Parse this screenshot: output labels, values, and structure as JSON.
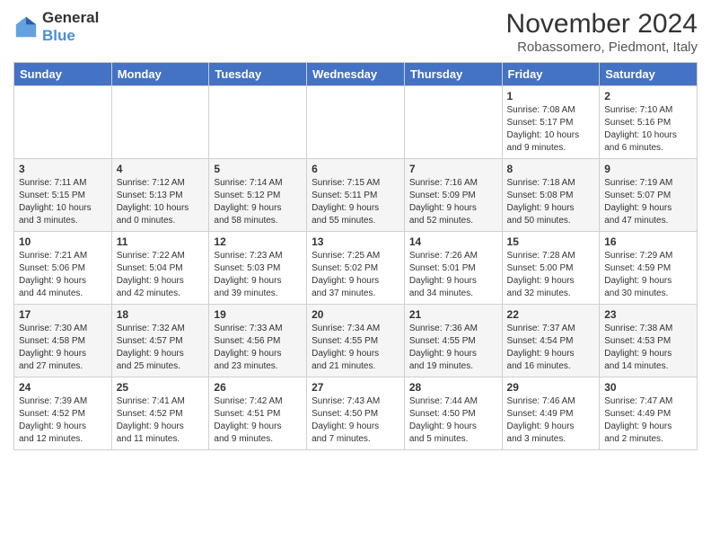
{
  "logo": {
    "general": "General",
    "blue": "Blue"
  },
  "header": {
    "title": "November 2024",
    "location": "Robassomero, Piedmont, Italy"
  },
  "days_of_week": [
    "Sunday",
    "Monday",
    "Tuesday",
    "Wednesday",
    "Thursday",
    "Friday",
    "Saturday"
  ],
  "weeks": [
    [
      {
        "day": "",
        "info": ""
      },
      {
        "day": "",
        "info": ""
      },
      {
        "day": "",
        "info": ""
      },
      {
        "day": "",
        "info": ""
      },
      {
        "day": "",
        "info": ""
      },
      {
        "day": "1",
        "info": "Sunrise: 7:08 AM\nSunset: 5:17 PM\nDaylight: 10 hours\nand 9 minutes."
      },
      {
        "day": "2",
        "info": "Sunrise: 7:10 AM\nSunset: 5:16 PM\nDaylight: 10 hours\nand 6 minutes."
      }
    ],
    [
      {
        "day": "3",
        "info": "Sunrise: 7:11 AM\nSunset: 5:15 PM\nDaylight: 10 hours\nand 3 minutes."
      },
      {
        "day": "4",
        "info": "Sunrise: 7:12 AM\nSunset: 5:13 PM\nDaylight: 10 hours\nand 0 minutes."
      },
      {
        "day": "5",
        "info": "Sunrise: 7:14 AM\nSunset: 5:12 PM\nDaylight: 9 hours\nand 58 minutes."
      },
      {
        "day": "6",
        "info": "Sunrise: 7:15 AM\nSunset: 5:11 PM\nDaylight: 9 hours\nand 55 minutes."
      },
      {
        "day": "7",
        "info": "Sunrise: 7:16 AM\nSunset: 5:09 PM\nDaylight: 9 hours\nand 52 minutes."
      },
      {
        "day": "8",
        "info": "Sunrise: 7:18 AM\nSunset: 5:08 PM\nDaylight: 9 hours\nand 50 minutes."
      },
      {
        "day": "9",
        "info": "Sunrise: 7:19 AM\nSunset: 5:07 PM\nDaylight: 9 hours\nand 47 minutes."
      }
    ],
    [
      {
        "day": "10",
        "info": "Sunrise: 7:21 AM\nSunset: 5:06 PM\nDaylight: 9 hours\nand 44 minutes."
      },
      {
        "day": "11",
        "info": "Sunrise: 7:22 AM\nSunset: 5:04 PM\nDaylight: 9 hours\nand 42 minutes."
      },
      {
        "day": "12",
        "info": "Sunrise: 7:23 AM\nSunset: 5:03 PM\nDaylight: 9 hours\nand 39 minutes."
      },
      {
        "day": "13",
        "info": "Sunrise: 7:25 AM\nSunset: 5:02 PM\nDaylight: 9 hours\nand 37 minutes."
      },
      {
        "day": "14",
        "info": "Sunrise: 7:26 AM\nSunset: 5:01 PM\nDaylight: 9 hours\nand 34 minutes."
      },
      {
        "day": "15",
        "info": "Sunrise: 7:28 AM\nSunset: 5:00 PM\nDaylight: 9 hours\nand 32 minutes."
      },
      {
        "day": "16",
        "info": "Sunrise: 7:29 AM\nSunset: 4:59 PM\nDaylight: 9 hours\nand 30 minutes."
      }
    ],
    [
      {
        "day": "17",
        "info": "Sunrise: 7:30 AM\nSunset: 4:58 PM\nDaylight: 9 hours\nand 27 minutes."
      },
      {
        "day": "18",
        "info": "Sunrise: 7:32 AM\nSunset: 4:57 PM\nDaylight: 9 hours\nand 25 minutes."
      },
      {
        "day": "19",
        "info": "Sunrise: 7:33 AM\nSunset: 4:56 PM\nDaylight: 9 hours\nand 23 minutes."
      },
      {
        "day": "20",
        "info": "Sunrise: 7:34 AM\nSunset: 4:55 PM\nDaylight: 9 hours\nand 21 minutes."
      },
      {
        "day": "21",
        "info": "Sunrise: 7:36 AM\nSunset: 4:55 PM\nDaylight: 9 hours\nand 19 minutes."
      },
      {
        "day": "22",
        "info": "Sunrise: 7:37 AM\nSunset: 4:54 PM\nDaylight: 9 hours\nand 16 minutes."
      },
      {
        "day": "23",
        "info": "Sunrise: 7:38 AM\nSunset: 4:53 PM\nDaylight: 9 hours\nand 14 minutes."
      }
    ],
    [
      {
        "day": "24",
        "info": "Sunrise: 7:39 AM\nSunset: 4:52 PM\nDaylight: 9 hours\nand 12 minutes."
      },
      {
        "day": "25",
        "info": "Sunrise: 7:41 AM\nSunset: 4:52 PM\nDaylight: 9 hours\nand 11 minutes."
      },
      {
        "day": "26",
        "info": "Sunrise: 7:42 AM\nSunset: 4:51 PM\nDaylight: 9 hours\nand 9 minutes."
      },
      {
        "day": "27",
        "info": "Sunrise: 7:43 AM\nSunset: 4:50 PM\nDaylight: 9 hours\nand 7 minutes."
      },
      {
        "day": "28",
        "info": "Sunrise: 7:44 AM\nSunset: 4:50 PM\nDaylight: 9 hours\nand 5 minutes."
      },
      {
        "day": "29",
        "info": "Sunrise: 7:46 AM\nSunset: 4:49 PM\nDaylight: 9 hours\nand 3 minutes."
      },
      {
        "day": "30",
        "info": "Sunrise: 7:47 AM\nSunset: 4:49 PM\nDaylight: 9 hours\nand 2 minutes."
      }
    ]
  ]
}
